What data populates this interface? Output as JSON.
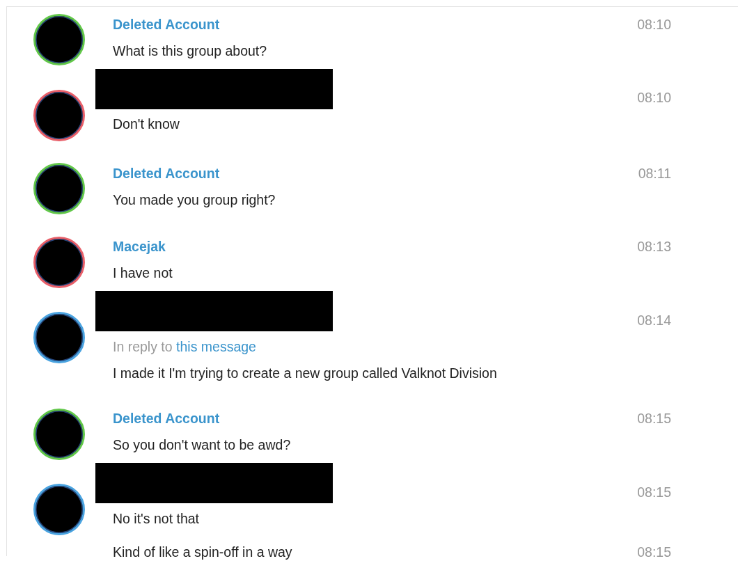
{
  "messages": [
    {
      "color": "#62c74a",
      "redacted": false,
      "author": "Deleted Account",
      "time": "08:10",
      "lines": [
        {
          "text": "What is this group about?"
        }
      ]
    },
    {
      "color": "#e8606a",
      "redacted": true,
      "time": "08:10",
      "lines": [
        {
          "text": "Don't know"
        }
      ]
    },
    {
      "color": "#62c74a",
      "redacted": false,
      "author": "Deleted Account",
      "time": "08:11",
      "lines": [
        {
          "text": "You made you group right?"
        }
      ]
    },
    {
      "color": "#e8606a",
      "redacted": false,
      "author": "Macejak",
      "time": "08:13",
      "lines": [
        {
          "text": "I have not"
        }
      ]
    },
    {
      "color": "#4aa3e0",
      "redacted": true,
      "time": "08:14",
      "reply": {
        "prefix": "In reply to",
        "link": "this message"
      },
      "lines": [
        {
          "text": "I made it I'm trying to create a new group called Valknot Division"
        }
      ]
    },
    {
      "color": "#62c74a",
      "redacted": false,
      "author": "Deleted Account",
      "time": "08:15",
      "lines": [
        {
          "text": "So you don't want to be awd?"
        }
      ]
    },
    {
      "color": "#4aa3e0",
      "redacted": true,
      "time": "08:15",
      "lines": [
        {
          "text": "No it's not that"
        },
        {
          "text": "Kind of like a spin-off in a way",
          "time": "08:15"
        }
      ]
    }
  ]
}
